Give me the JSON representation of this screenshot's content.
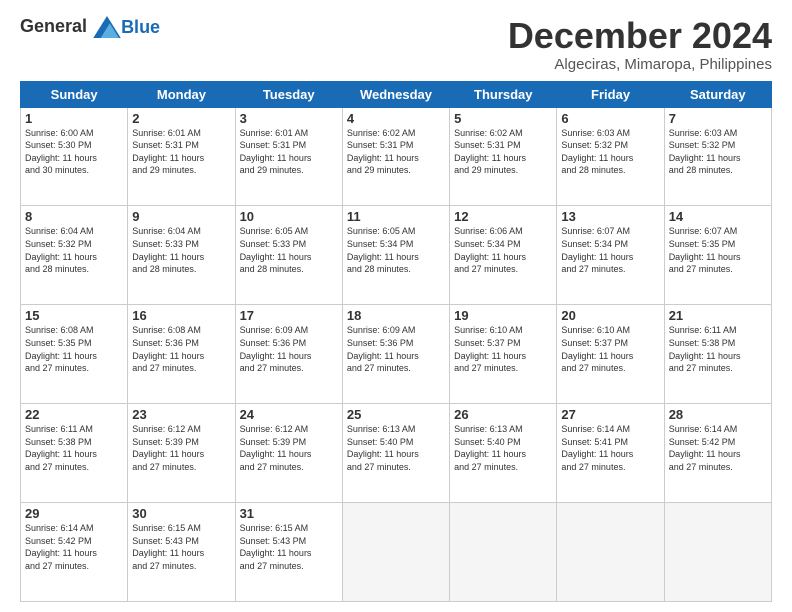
{
  "header": {
    "logo_general": "General",
    "logo_blue": "Blue",
    "main_title": "December 2024",
    "subtitle": "Algeciras, Mimaropa, Philippines"
  },
  "calendar": {
    "days_of_week": [
      "Sunday",
      "Monday",
      "Tuesday",
      "Wednesday",
      "Thursday",
      "Friday",
      "Saturday"
    ],
    "weeks": [
      [
        {
          "day": "",
          "info": ""
        },
        {
          "day": "2",
          "info": "Sunrise: 6:01 AM\nSunset: 5:31 PM\nDaylight: 11 hours\nand 29 minutes."
        },
        {
          "day": "3",
          "info": "Sunrise: 6:01 AM\nSunset: 5:31 PM\nDaylight: 11 hours\nand 29 minutes."
        },
        {
          "day": "4",
          "info": "Sunrise: 6:02 AM\nSunset: 5:31 PM\nDaylight: 11 hours\nand 29 minutes."
        },
        {
          "day": "5",
          "info": "Sunrise: 6:02 AM\nSunset: 5:31 PM\nDaylight: 11 hours\nand 29 minutes."
        },
        {
          "day": "6",
          "info": "Sunrise: 6:03 AM\nSunset: 5:32 PM\nDaylight: 11 hours\nand 28 minutes."
        },
        {
          "day": "7",
          "info": "Sunrise: 6:03 AM\nSunset: 5:32 PM\nDaylight: 11 hours\nand 28 minutes."
        }
      ],
      [
        {
          "day": "1",
          "info": "Sunrise: 6:00 AM\nSunset: 5:30 PM\nDaylight: 11 hours\nand 30 minutes."
        },
        {
          "day": "9",
          "info": "Sunrise: 6:04 AM\nSunset: 5:33 PM\nDaylight: 11 hours\nand 28 minutes."
        },
        {
          "day": "10",
          "info": "Sunrise: 6:05 AM\nSunset: 5:33 PM\nDaylight: 11 hours\nand 28 minutes."
        },
        {
          "day": "11",
          "info": "Sunrise: 6:05 AM\nSunset: 5:34 PM\nDaylight: 11 hours\nand 28 minutes."
        },
        {
          "day": "12",
          "info": "Sunrise: 6:06 AM\nSunset: 5:34 PM\nDaylight: 11 hours\nand 27 minutes."
        },
        {
          "day": "13",
          "info": "Sunrise: 6:07 AM\nSunset: 5:34 PM\nDaylight: 11 hours\nand 27 minutes."
        },
        {
          "day": "14",
          "info": "Sunrise: 6:07 AM\nSunset: 5:35 PM\nDaylight: 11 hours\nand 27 minutes."
        }
      ],
      [
        {
          "day": "8",
          "info": "Sunrise: 6:04 AM\nSunset: 5:32 PM\nDaylight: 11 hours\nand 28 minutes."
        },
        {
          "day": "16",
          "info": "Sunrise: 6:08 AM\nSunset: 5:36 PM\nDaylight: 11 hours\nand 27 minutes."
        },
        {
          "day": "17",
          "info": "Sunrise: 6:09 AM\nSunset: 5:36 PM\nDaylight: 11 hours\nand 27 minutes."
        },
        {
          "day": "18",
          "info": "Sunrise: 6:09 AM\nSunset: 5:36 PM\nDaylight: 11 hours\nand 27 minutes."
        },
        {
          "day": "19",
          "info": "Sunrise: 6:10 AM\nSunset: 5:37 PM\nDaylight: 11 hours\nand 27 minutes."
        },
        {
          "day": "20",
          "info": "Sunrise: 6:10 AM\nSunset: 5:37 PM\nDaylight: 11 hours\nand 27 minutes."
        },
        {
          "day": "21",
          "info": "Sunrise: 6:11 AM\nSunset: 5:38 PM\nDaylight: 11 hours\nand 27 minutes."
        }
      ],
      [
        {
          "day": "15",
          "info": "Sunrise: 6:08 AM\nSunset: 5:35 PM\nDaylight: 11 hours\nand 27 minutes."
        },
        {
          "day": "23",
          "info": "Sunrise: 6:12 AM\nSunset: 5:39 PM\nDaylight: 11 hours\nand 27 minutes."
        },
        {
          "day": "24",
          "info": "Sunrise: 6:12 AM\nSunset: 5:39 PM\nDaylight: 11 hours\nand 27 minutes."
        },
        {
          "day": "25",
          "info": "Sunrise: 6:13 AM\nSunset: 5:40 PM\nDaylight: 11 hours\nand 27 minutes."
        },
        {
          "day": "26",
          "info": "Sunrise: 6:13 AM\nSunset: 5:40 PM\nDaylight: 11 hours\nand 27 minutes."
        },
        {
          "day": "27",
          "info": "Sunrise: 6:14 AM\nSunset: 5:41 PM\nDaylight: 11 hours\nand 27 minutes."
        },
        {
          "day": "28",
          "info": "Sunrise: 6:14 AM\nSunset: 5:42 PM\nDaylight: 11 hours\nand 27 minutes."
        }
      ],
      [
        {
          "day": "22",
          "info": "Sunrise: 6:11 AM\nSunset: 5:38 PM\nDaylight: 11 hours\nand 27 minutes."
        },
        {
          "day": "30",
          "info": "Sunrise: 6:15 AM\nSunset: 5:43 PM\nDaylight: 11 hours\nand 27 minutes."
        },
        {
          "day": "31",
          "info": "Sunrise: 6:15 AM\nSunset: 5:43 PM\nDaylight: 11 hours\nand 27 minutes."
        },
        {
          "day": "",
          "info": ""
        },
        {
          "day": "",
          "info": ""
        },
        {
          "day": "",
          "info": ""
        },
        {
          "day": ""
        }
      ],
      [
        {
          "day": "29",
          "info": "Sunrise: 6:14 AM\nSunset: 5:42 PM\nDaylight: 11 hours\nand 27 minutes."
        },
        {
          "day": "",
          "info": ""
        },
        {
          "day": "",
          "info": ""
        },
        {
          "day": "",
          "info": ""
        },
        {
          "day": "",
          "info": ""
        },
        {
          "day": "",
          "info": ""
        },
        {
          "day": "",
          "info": ""
        }
      ]
    ]
  }
}
